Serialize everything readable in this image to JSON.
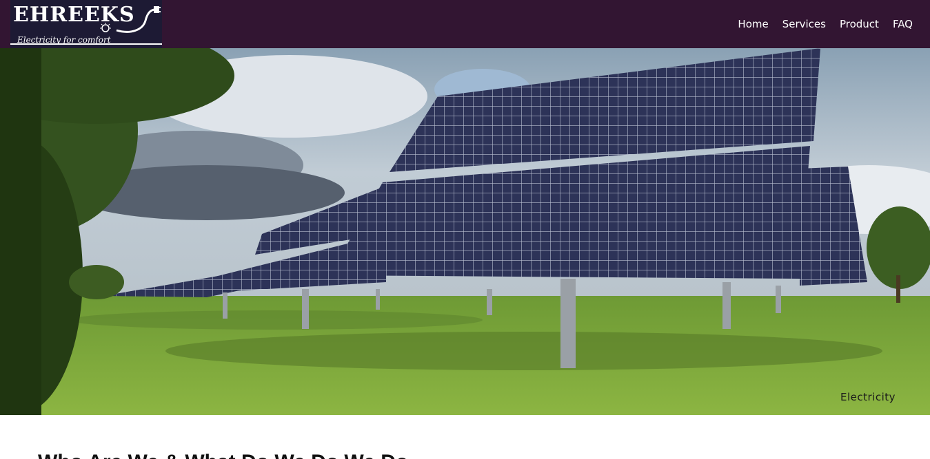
{
  "brand": {
    "name": "Ehreeks",
    "tagline": "Electricity for comfort"
  },
  "nav": {
    "items": [
      {
        "label": "Home"
      },
      {
        "label": "Services"
      },
      {
        "label": "Product"
      },
      {
        "label": "FAQ"
      }
    ]
  },
  "hero": {
    "caption": "Electricity",
    "icon": "solar-panel-field-photo"
  },
  "content": {
    "heading": "Who Are We & What Do We Do We Do"
  },
  "colors": {
    "navbar": "#321532",
    "logo_bg": "#1d1a34",
    "nav_text": "#ffffff"
  }
}
